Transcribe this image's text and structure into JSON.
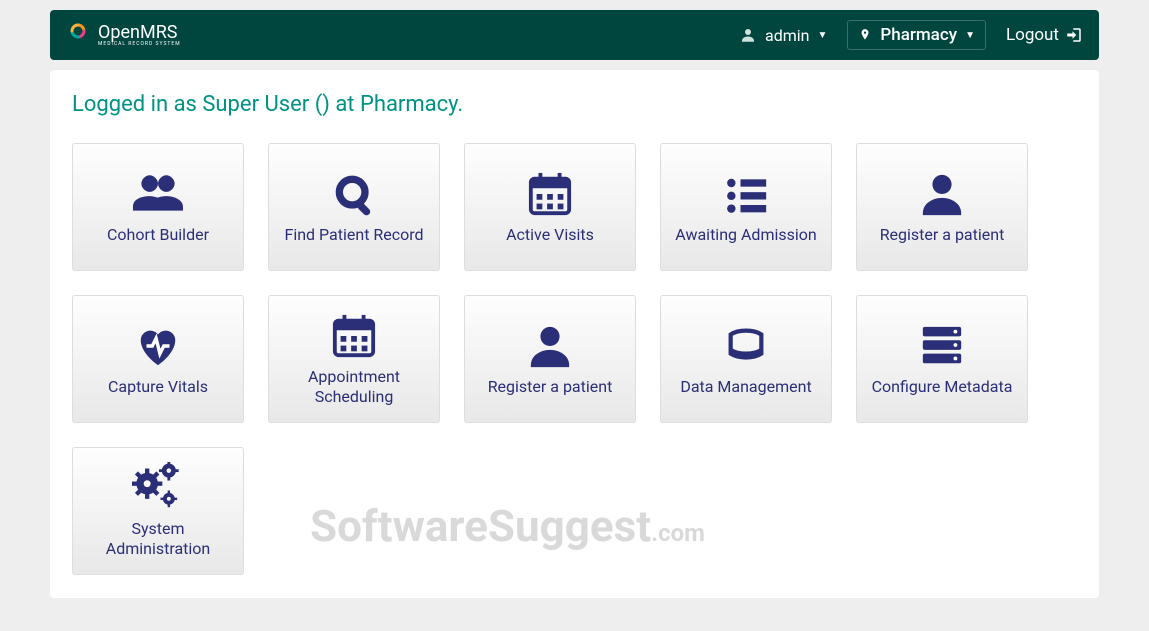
{
  "brand": {
    "name": "OpenMRS",
    "tagline": "MEDICAL RECORD SYSTEM"
  },
  "header": {
    "username": "admin",
    "location": "Pharmacy",
    "logout": "Logout"
  },
  "welcome": "Logged in as Super User () at Pharmacy.",
  "watermark": {
    "main": "SoftwareSuggest",
    "dot": ".",
    "suffix": "com"
  },
  "apps": [
    {
      "label": "Cohort Builder",
      "icon": "users-icon"
    },
    {
      "label": "Find Patient Record",
      "icon": "search-icon"
    },
    {
      "label": "Active Visits",
      "icon": "calendar-icon"
    },
    {
      "label": "Awaiting Admission",
      "icon": "list-icon"
    },
    {
      "label": "Register a patient",
      "icon": "user-icon"
    },
    {
      "label": "Capture Vitals",
      "icon": "heartbeat-icon"
    },
    {
      "label": "Appointment Scheduling",
      "icon": "calendar-icon"
    },
    {
      "label": "Register a patient",
      "icon": "user-icon"
    },
    {
      "label": "Data Management",
      "icon": "hdd-icon"
    },
    {
      "label": "Configure Metadata",
      "icon": "server-icon"
    },
    {
      "label": "System Administration",
      "icon": "gears-icon"
    }
  ]
}
